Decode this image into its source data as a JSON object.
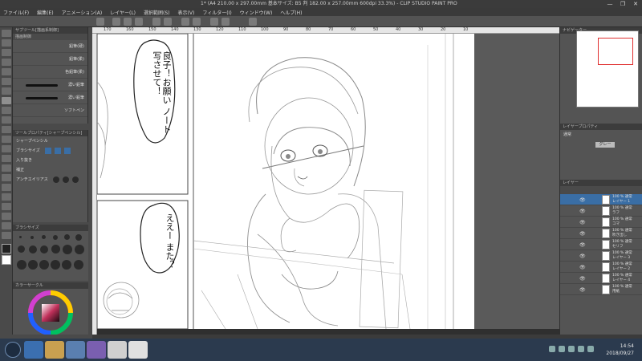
{
  "window": {
    "title": "1* (A4 210.00 x 297.00mm 基本サイズ: B5 判 182.00 x 257.00mm 600dpi 33.3%) - CLIP STUDIO PAINT PRO",
    "controls": [
      "—",
      "❐",
      "✕"
    ]
  },
  "menu": [
    "ファイル(F)",
    "編集(E)",
    "アニメーション(A)",
    "レイヤー(L)",
    "選択範囲(S)",
    "表示(V)",
    "フィルター(I)",
    "ウィンドウ(W)",
    "ヘルプ(H)"
  ],
  "ruler": [
    "170",
    "160",
    "150",
    "140",
    "130",
    "120",
    "110",
    "100",
    "90",
    "80",
    "70",
    "60",
    "50",
    "40",
    "30",
    "20",
    "10"
  ],
  "subtool": {
    "header": "サブツール[描画系制御]",
    "tab": "描画制御",
    "items": [
      "鉛筆(硬)",
      "鉛筆(柔)",
      "色鉛筆(柔)",
      "濃い鉛筆",
      "濃い鉛筆",
      "ソフトペン"
    ]
  },
  "toolprop": {
    "header": "ツールプロパティ[シャープペンシル]",
    "name": "シャープペンシル",
    "rows": [
      "ブラシサイズ",
      "入り抜き",
      "補正",
      "アンチエイリアス"
    ]
  },
  "brushsize": {
    "header": "ブラシサイズ"
  },
  "colorwheel": {
    "header": "カラーサークル"
  },
  "canvas": {
    "balloon1": "良子！お願い ノート写させて！",
    "balloon2": "ええー また？"
  },
  "navigator": {
    "header": "ナビゲーター"
  },
  "layerprop": {
    "header": "レイヤープロパティ",
    "mode": "通常",
    "color_label": "グレー"
  },
  "layers": {
    "header": "レイヤー",
    "rows": [
      {
        "name": "100 % 通常",
        "sub": "レイヤー 1"
      },
      {
        "name": "100 % 通常",
        "sub": "ラフ"
      },
      {
        "name": "100 % 通常",
        "sub": "コマ"
      },
      {
        "name": "100 % 通常",
        "sub": "吹き出し"
      },
      {
        "name": "100 % 通常",
        "sub": "セリフ"
      },
      {
        "name": "100 % 通常",
        "sub": "レイヤー 3"
      },
      {
        "name": "100 % 通常",
        "sub": "レイヤー 2"
      },
      {
        "name": "100 % 通常",
        "sub": "レイヤー 4"
      },
      {
        "name": "100 % 通常",
        "sub": "用紙"
      }
    ]
  },
  "taskbar": {
    "time": "14:54",
    "date": "2018/09/27"
  },
  "colors": {
    "accent": "#3a6ea5",
    "panel": "#545454",
    "sketch": "#8a8a8a"
  }
}
